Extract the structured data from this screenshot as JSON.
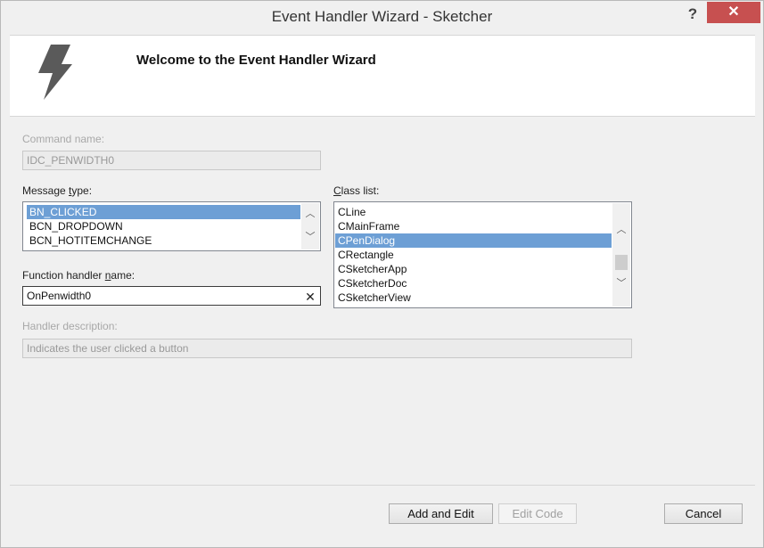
{
  "window": {
    "title": "Event Handler Wizard - Sketcher",
    "help_label": "?",
    "close_label": "✕"
  },
  "header": {
    "title": "Welcome to the Event Handler Wizard",
    "icon": "lightning-icon"
  },
  "command": {
    "label": "Command name:",
    "value": "IDC_PENWIDTH0"
  },
  "message_type": {
    "label": "Message type:",
    "items": [
      "BN_CLICKED",
      "BCN_DROPDOWN",
      "BCN_HOTITEMCHANGE"
    ],
    "selected_index": 0
  },
  "class_list": {
    "label": "Class list:",
    "items": [
      "CLine",
      "CMainFrame",
      "CPenDialog",
      "CRectangle",
      "CSketcherApp",
      "CSketcherDoc",
      "CSketcherView"
    ],
    "selected_index": 2
  },
  "function_handler": {
    "label": "Function handler name:",
    "value": "OnPenwidth0"
  },
  "handler_description": {
    "label": "Handler description:",
    "value": "Indicates the user clicked a button"
  },
  "buttons": {
    "add_edit": "Add and Edit",
    "edit_code": "Edit Code",
    "cancel": "Cancel"
  },
  "colors": {
    "selection": "#6d9fd5",
    "close_button": "#c75050"
  }
}
